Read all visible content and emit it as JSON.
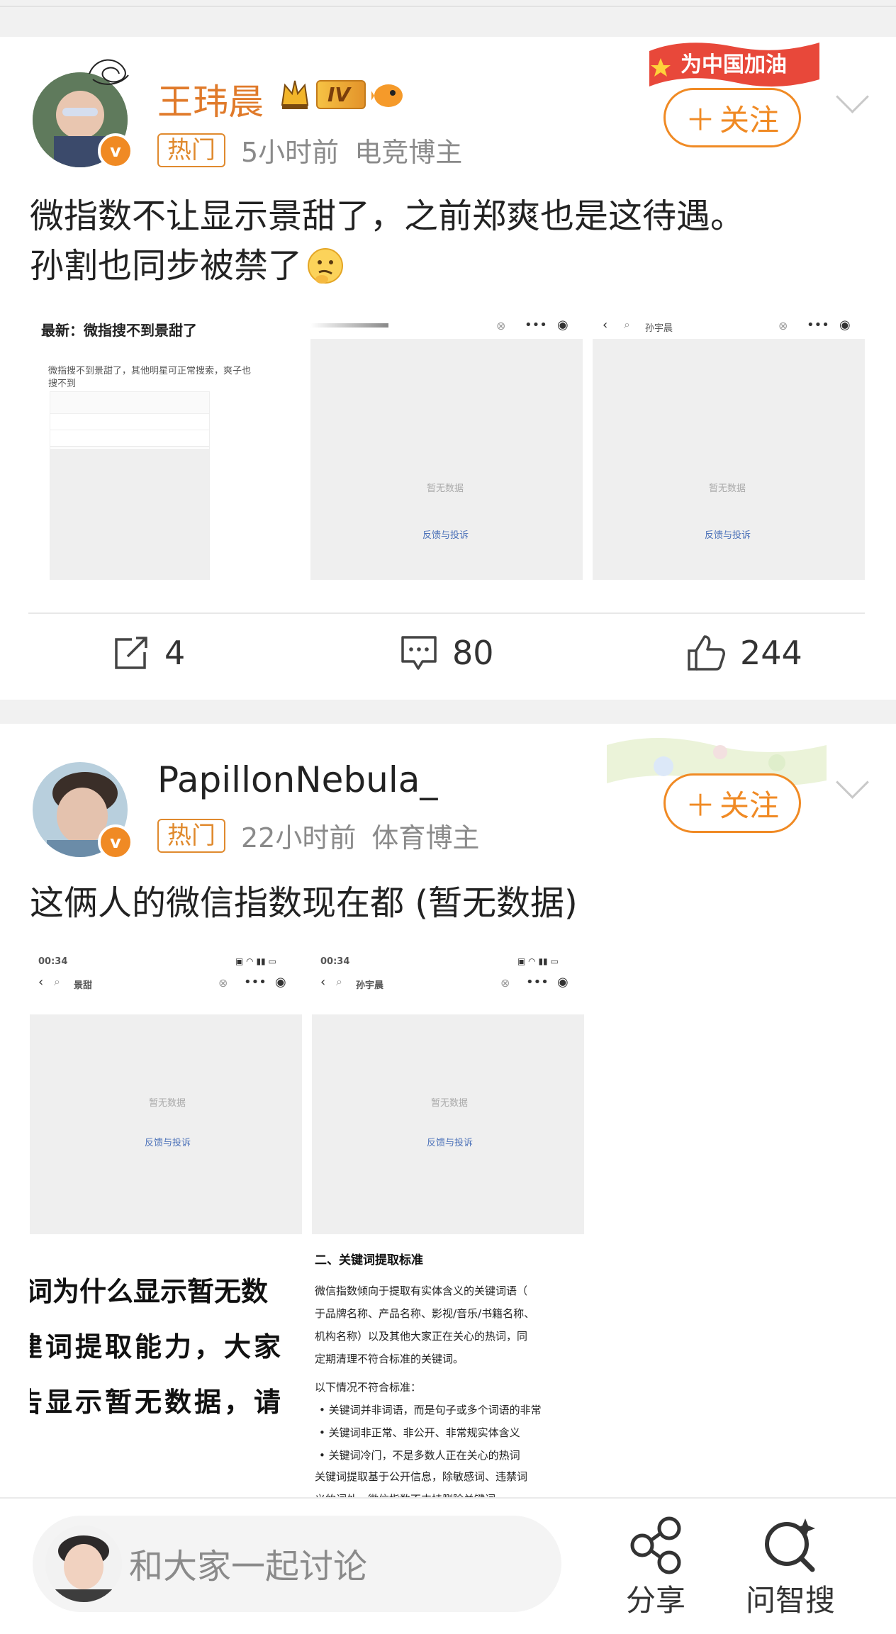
{
  "posts": [
    {
      "username": "王玮晨",
      "level_badge": "IV",
      "hot_tag": "热门",
      "time": "5小时前",
      "role": "电竞博主",
      "follow_label": "关注",
      "follow_banner": "为中国加油",
      "text_line1": "微指数不让显示景甜了，之前郑爽也是这待遇。",
      "text_line2": "孙割也同步被禁了",
      "images": {
        "img1_title": "最新：微指搜不到景甜了",
        "img1_text_a": "微指搜不到景甜了，其他明星可正常搜索，爽子也",
        "img1_text_b": "搜不到",
        "img2_empty": "暂无数据",
        "img2_link": "反馈与投诉",
        "img3_search": "孙宇晨",
        "img3_empty": "暂无数据",
        "img3_link": "反馈与投诉"
      },
      "share_count": "4",
      "comment_count": "80",
      "like_count": "244"
    },
    {
      "username": "PapillonNebula_",
      "hot_tag": "热门",
      "time": "22小时前",
      "role": "体育博主",
      "follow_label": "关注",
      "text": "这俩人的微信指数现在都 (暂无数据)",
      "images": {
        "img1_time": "00:34",
        "img1_search": "景甜",
        "img1_empty": "暂无数据",
        "img1_link": "反馈与投诉",
        "img2_time": "00:34",
        "img2_search": "孙宇晨",
        "img2_empty": "暂无数据",
        "img2_link": "反馈与投诉",
        "img3_line1": "词为什么显示暂无数",
        "img3_line2": "建词提取能力，大家",
        "img3_line3": "告显示暂无数据，请",
        "img4_heading": "二、关键词提取标准",
        "img4_p1_a": "微信指数倾向于提取有实体含义的关键词语（",
        "img4_p1_b": "于品牌名称、产品名称、影视/音乐/书籍名称、",
        "img4_p1_c": "机构名称）以及其他大家正在关心的热词，同",
        "img4_p1_d": "定期清理不符合标准的关键词。",
        "img4_p2": "以下情况不符合标准：",
        "img4_b1": "• 关键词并非词语，而是句子或多个词语的非常",
        "img4_b2": "• 关键词非正常、非公开、非常规实体含义",
        "img4_b3": "• 关键词冷门，不是多数人正在关心的热词",
        "img4_p3_a": "关键词提取基于公开信息，除敏感词、违禁词",
        "img4_p3_b": "义的词外，微信指数不支持删除关键词。"
      }
    }
  ],
  "bottom_bar": {
    "input_placeholder": "和大家一起讨论",
    "share_label": "分享",
    "ask_label": "问智搜"
  },
  "colors": {
    "accent": "#f08a24",
    "username_orange": "#e07a2a",
    "link_blue": "#4a70b8"
  }
}
